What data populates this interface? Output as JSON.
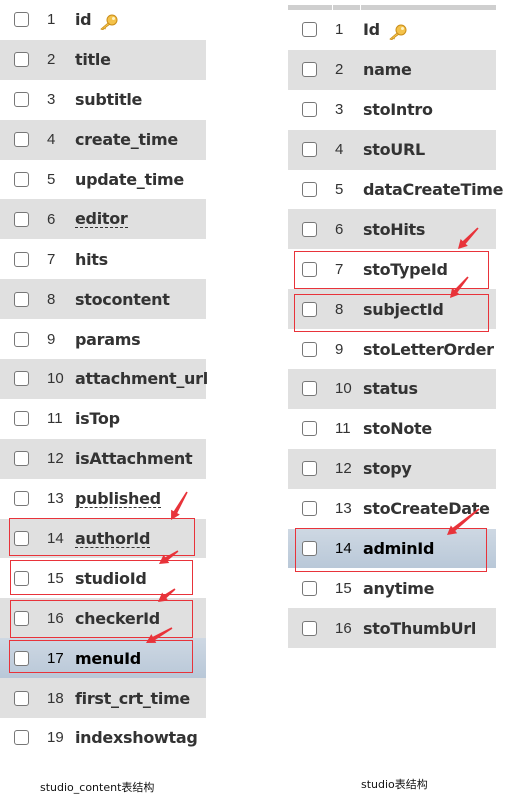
{
  "left_table": {
    "caption": "studio_content表结构",
    "rows": [
      {
        "num": "1",
        "name": "id",
        "primary_key": true
      },
      {
        "num": "2",
        "name": "title"
      },
      {
        "num": "3",
        "name": "subtitle"
      },
      {
        "num": "4",
        "name": "create_time"
      },
      {
        "num": "5",
        "name": "update_time"
      },
      {
        "num": "6",
        "name": "editor",
        "dashed": true
      },
      {
        "num": "7",
        "name": "hits"
      },
      {
        "num": "8",
        "name": "stocontent"
      },
      {
        "num": "9",
        "name": "params"
      },
      {
        "num": "10",
        "name": "attachment_url"
      },
      {
        "num": "11",
        "name": "isTop"
      },
      {
        "num": "12",
        "name": "isAttachment"
      },
      {
        "num": "13",
        "name": "published",
        "dashed": true
      },
      {
        "num": "14",
        "name": "authorId",
        "dashed": true,
        "highlighted": true
      },
      {
        "num": "15",
        "name": "studioId",
        "highlighted": true
      },
      {
        "num": "16",
        "name": "checkerId",
        "highlighted": true
      },
      {
        "num": "17",
        "name": "menuId",
        "highlighted": true,
        "selected": true
      },
      {
        "num": "18",
        "name": "first_crt_time"
      },
      {
        "num": "19",
        "name": "indexshowtag"
      }
    ]
  },
  "right_table": {
    "caption": "studio表结构",
    "rows": [
      {
        "num": "1",
        "name": "Id",
        "primary_key": true
      },
      {
        "num": "2",
        "name": "name"
      },
      {
        "num": "3",
        "name": "stoIntro"
      },
      {
        "num": "4",
        "name": "stoURL"
      },
      {
        "num": "5",
        "name": "dataCreateTime"
      },
      {
        "num": "6",
        "name": "stoHits"
      },
      {
        "num": "7",
        "name": "stoTypeId",
        "highlighted": true
      },
      {
        "num": "8",
        "name": "subjectId",
        "highlighted": true
      },
      {
        "num": "9",
        "name": "stoLetterOrder"
      },
      {
        "num": "10",
        "name": "status"
      },
      {
        "num": "11",
        "name": "stoNote"
      },
      {
        "num": "12",
        "name": "stopy"
      },
      {
        "num": "13",
        "name": "stoCreateDate"
      },
      {
        "num": "14",
        "name": "adminId",
        "highlighted": true,
        "selected": true
      },
      {
        "num": "15",
        "name": "anytime"
      },
      {
        "num": "16",
        "name": "stoThumbUrl"
      }
    ]
  },
  "colors": {
    "highlight": "#e8333a",
    "row_alt": "#e0e0e0",
    "row_selected": "#c3d0de"
  },
  "icons": {
    "primary_key": "key-icon",
    "annotation": "red-arrow-icon"
  }
}
